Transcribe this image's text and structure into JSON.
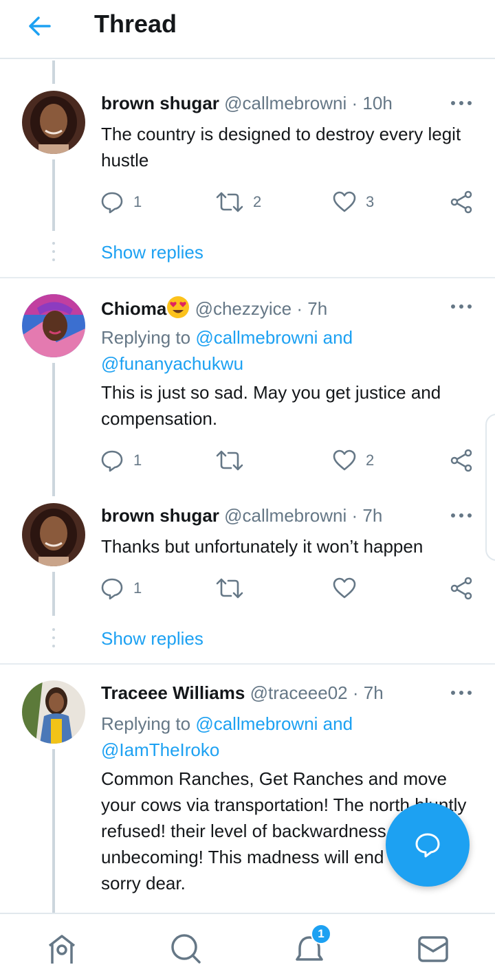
{
  "header": {
    "title": "Thread"
  },
  "colors": {
    "accent": "#1da1f2",
    "text": "#14171a",
    "muted": "#657786",
    "line": "#ccd6dd"
  },
  "tweets": [
    {
      "name": "brown shugar",
      "handle": "@callmebrowni",
      "dot": "·",
      "time": "10h",
      "text": "The country is designed to destroy every legit hustle",
      "counts": {
        "reply": "1",
        "retweet": "2",
        "like": "3"
      },
      "show_replies": "Show replies"
    },
    {
      "name": "Chioma",
      "emoji": "heart-eyes-emoji",
      "handle": "@chezzyice",
      "dot": "·",
      "time": "7h",
      "replying_prefix": "Replying to",
      "mention_1": "@callmebrowni and",
      "mention_2": "@funanyachukwu",
      "text": "This is just so sad. May you get justice and compensation.",
      "counts": {
        "reply": "1",
        "retweet": "",
        "like": "2"
      }
    },
    {
      "name": "brown shugar",
      "handle": "@callmebrowni",
      "dot": "·",
      "time": "7h",
      "text": "Thanks but unfortunately it won’t happen",
      "counts": {
        "reply": "1",
        "retweet": "",
        "like": ""
      },
      "show_replies": "Show replies"
    },
    {
      "name": "Traceee Williams",
      "handle": "@traceee02",
      "dot": "·",
      "time": "7h",
      "replying_prefix": "Replying to",
      "mention_1": "@callmebrowni and",
      "mention_2": "@IamTheIroko",
      "text": "Common Ranches, Get Ranches and move your cows via transportation! The north bluntly refused! their level of backwardness is unbecoming! This madness will end soon. So sorry dear."
    }
  ],
  "nav": {
    "items": [
      "home-icon",
      "search-icon",
      "notifications-icon",
      "messages-icon"
    ],
    "notification_badge": "1"
  },
  "fab": {
    "icon": "compose-reply-icon"
  }
}
